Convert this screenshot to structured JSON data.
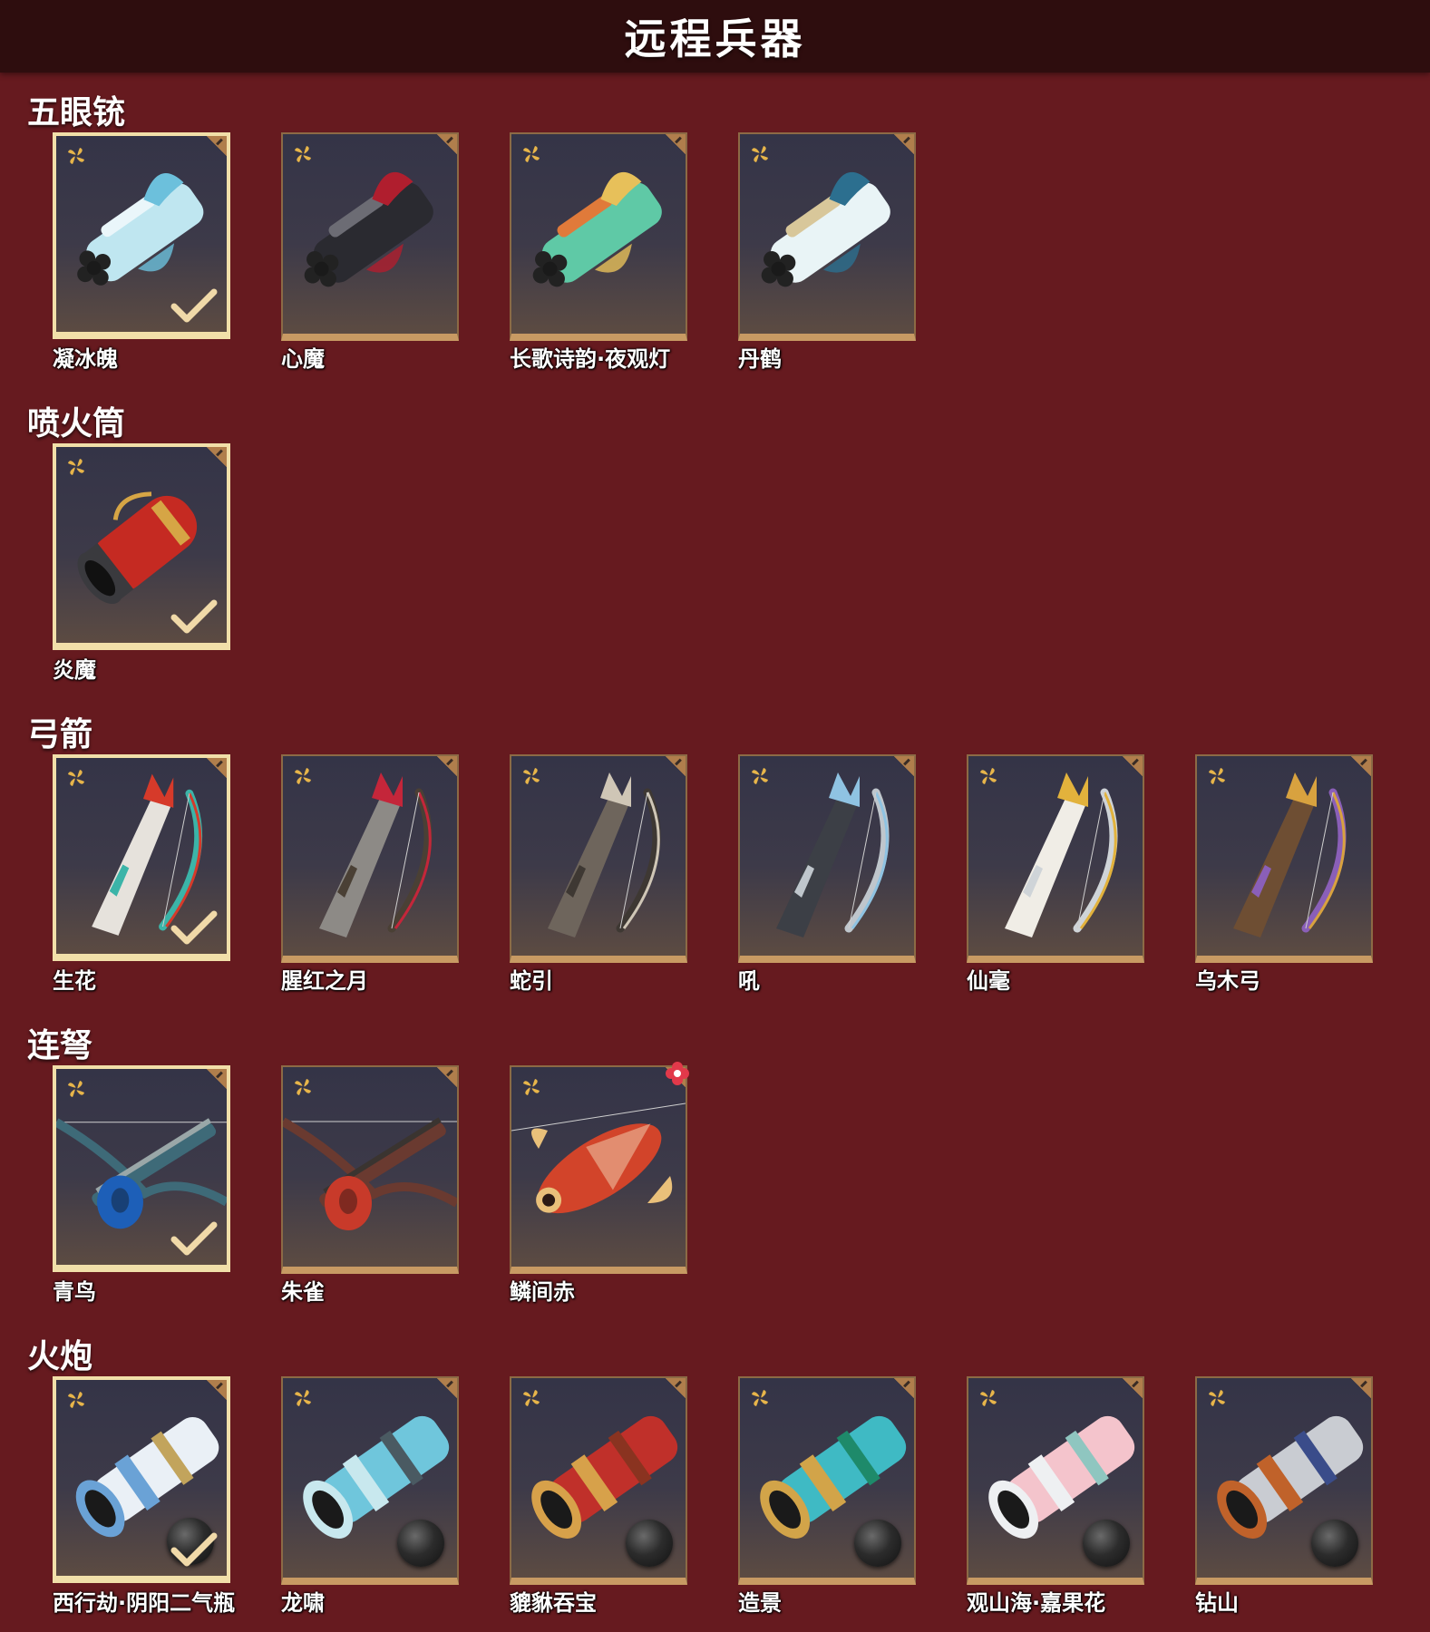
{
  "header": {
    "title": "远程兵器"
  },
  "sections": [
    {
      "title": "五眼铳",
      "items": [
        {
          "name": "凝冰魄",
          "equipped": true,
          "art": "gun",
          "colors": [
            "#bfe6f0",
            "#6cc0dc",
            "#eaf6fa"
          ]
        },
        {
          "name": "心魔",
          "equipped": false,
          "art": "gun",
          "colors": [
            "#2a2a30",
            "#b01e2e",
            "#6c6c74"
          ]
        },
        {
          "name": "长歌诗韵·夜观灯",
          "equipped": false,
          "art": "gun",
          "colors": [
            "#5fc9a6",
            "#e7c05a",
            "#e07a3a"
          ]
        },
        {
          "name": "丹鹤",
          "equipped": false,
          "art": "gun",
          "colors": [
            "#e9f4f6",
            "#2c6f8f",
            "#d8c79a"
          ]
        }
      ]
    },
    {
      "title": "喷火筒",
      "items": [
        {
          "name": "炎魔",
          "equipped": true,
          "art": "tube",
          "colors": [
            "#c52a22",
            "#3a3a3e",
            "#d6a545"
          ]
        }
      ]
    },
    {
      "title": "弓箭",
      "items": [
        {
          "name": "生花",
          "equipped": true,
          "art": "bow",
          "colors": [
            "#e6e2dc",
            "#d63a2a",
            "#3bb4a8"
          ]
        },
        {
          "name": "腥红之月",
          "equipped": false,
          "art": "bow",
          "colors": [
            "#8d8a86",
            "#c4263a",
            "#4a4035"
          ]
        },
        {
          "name": "蛇引",
          "equipped": false,
          "art": "bow",
          "colors": [
            "#6e655c",
            "#cfc6b6",
            "#3e3833"
          ]
        },
        {
          "name": "吼",
          "equipped": false,
          "art": "bow",
          "colors": [
            "#3c3f46",
            "#8fc3e2",
            "#bfc6cc"
          ]
        },
        {
          "name": "仙毫",
          "equipped": false,
          "art": "bow",
          "colors": [
            "#f0ede6",
            "#e2b23c",
            "#cfd4d8"
          ]
        },
        {
          "name": "乌木弓",
          "equipped": false,
          "art": "bow",
          "colors": [
            "#6e4e33",
            "#d8a23f",
            "#8a5fb8"
          ]
        }
      ]
    },
    {
      "title": "连弩",
      "items": [
        {
          "name": "青鸟",
          "equipped": true,
          "art": "crossbow",
          "colors": [
            "#3e6a78",
            "#1d5fb8",
            "#9aa7a8"
          ]
        },
        {
          "name": "朱雀",
          "equipped": false,
          "art": "crossbow",
          "colors": [
            "#6a3a30",
            "#c83a2a",
            "#3a3430"
          ]
        },
        {
          "name": "鳞间赤",
          "equipped": false,
          "art": "fish",
          "colors": [
            "#d2442a",
            "#e9c07a",
            "#f6e6c6"
          ],
          "badge": true
        }
      ]
    },
    {
      "title": "火炮",
      "items": [
        {
          "name": "西行劫·阴阳二气瓶",
          "equipped": true,
          "art": "cannon",
          "colors": [
            "#eaf0f6",
            "#6aa2d6",
            "#c2a45c"
          ]
        },
        {
          "name": "龙啸",
          "equipped": false,
          "art": "cannon",
          "colors": [
            "#6fc6dc",
            "#c8e8ee",
            "#4a5a62"
          ]
        },
        {
          "name": "貔貅吞宝",
          "equipped": false,
          "art": "cannon",
          "colors": [
            "#c0302a",
            "#d7a14a",
            "#8a3320"
          ]
        },
        {
          "name": "造景",
          "equipped": false,
          "art": "cannon",
          "colors": [
            "#3fbac4",
            "#d2a449",
            "#1e8a6a"
          ]
        },
        {
          "name": "观山海·嘉果花",
          "equipped": false,
          "art": "cannon",
          "colors": [
            "#f4c4cc",
            "#eef0f2",
            "#8fc6c0"
          ]
        },
        {
          "name": "钻山",
          "equipped": false,
          "art": "cannon",
          "colors": [
            "#c9ccd2",
            "#c0622a",
            "#3a4c8a"
          ]
        }
      ]
    }
  ]
}
